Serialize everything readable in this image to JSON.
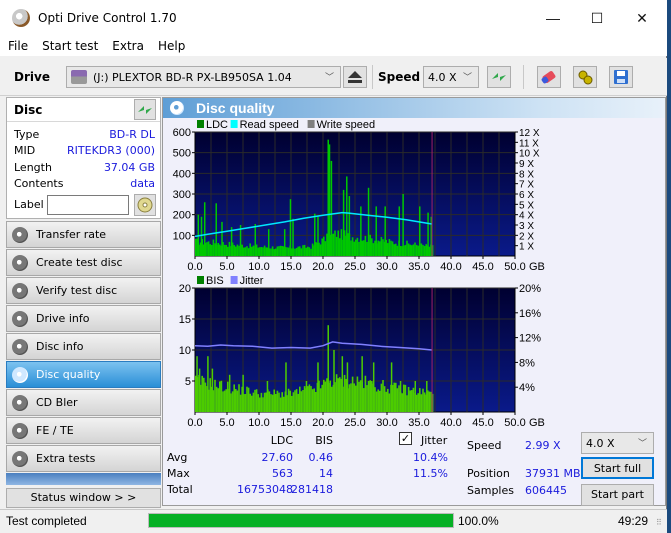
{
  "window": {
    "title": "Opti Drive Control 1.70",
    "controls": {
      "minimize": "—",
      "maximize": "☐",
      "close": "✕"
    }
  },
  "menu": [
    "File",
    "Start test",
    "Extra",
    "Help"
  ],
  "toolbar": {
    "drive_label": "Drive",
    "drive_value": "(J:)  PLEXTOR BD-R  PX-LB950SA 1.04",
    "speed_label": "Speed",
    "speed_value": "4.0 X",
    "icons": [
      "eject-icon",
      "refresh-icon",
      "erase-icon",
      "settings-icon",
      "save-icon"
    ]
  },
  "disc": {
    "title": "Disc",
    "fields": [
      {
        "key": "Type",
        "value": "BD-R DL"
      },
      {
        "key": "MID",
        "value": "RITEKDR3 (000)"
      },
      {
        "key": "Length",
        "value": "37.04 GB"
      },
      {
        "key": "Contents",
        "value": "data"
      }
    ],
    "label_key": "Label",
    "label_value": ""
  },
  "nav": [
    {
      "label": "Transfer rate",
      "active": false
    },
    {
      "label": "Create test disc",
      "active": false
    },
    {
      "label": "Verify test disc",
      "active": false
    },
    {
      "label": "Drive info",
      "active": false
    },
    {
      "label": "Disc info",
      "active": false
    },
    {
      "label": "Disc quality",
      "active": true
    },
    {
      "label": "CD Bler",
      "active": false
    },
    {
      "label": "FE / TE",
      "active": false
    },
    {
      "label": "Extra tests",
      "active": false
    }
  ],
  "status_window_label": "Status window > >",
  "panel": {
    "title": "Disc quality"
  },
  "stats": {
    "col_ldc": "LDC",
    "col_bis": "BIS",
    "jitter_label": "Jitter",
    "jitter_checked": true,
    "rows": [
      {
        "label": "Avg",
        "ldc": "27.60",
        "bis": "0.46",
        "jitter": "10.4%"
      },
      {
        "label": "Max",
        "ldc": "563",
        "bis": "14",
        "jitter": "11.5%"
      },
      {
        "label": "Total",
        "ldc": "16753048",
        "bis": "281418",
        "jitter": ""
      }
    ],
    "speed_label": "Speed",
    "speed_value": "2.99 X",
    "position_label": "Position",
    "position_value": "37931 MB",
    "samples_label": "Samples",
    "samples_value": "606445",
    "speed_select": "4.0 X",
    "start_full": "Start full",
    "start_part": "Start part"
  },
  "statusbar": {
    "text": "Test completed",
    "progress": 1.0,
    "progress_text": "100.0%",
    "time": "49:29"
  },
  "colors": {
    "plot_bg_top": "#000030",
    "plot_bg_bottom": "#0a1a8a",
    "ldc": "#00c800",
    "bis": "#4ccc00",
    "read_speed": "#00e8ff",
    "jitter": "#8080ff",
    "end_marker": "#a0206a"
  },
  "chart_data": [
    {
      "type": "bar",
      "title": "LDC / Read speed",
      "legend": [
        "LDC",
        "Read speed",
        "Write speed"
      ],
      "legend_colors": [
        "#008000",
        "#00ffff",
        "#808080"
      ],
      "xlabel": "GB",
      "x_ticks": [
        "0.0",
        "5.0",
        "10.0",
        "15.0",
        "20.0",
        "25.0",
        "30.0",
        "35.0",
        "40.0",
        "45.0",
        "50.0"
      ],
      "xlim": [
        0,
        50
      ],
      "y_ticks": [
        100,
        200,
        300,
        400,
        500,
        600
      ],
      "ylim": [
        0,
        600
      ],
      "y2_ticks": [
        "1 X",
        "2 X",
        "3 X",
        "4 X",
        "5 X",
        "6 X",
        "7 X",
        "8 X",
        "9 X",
        "10 X",
        "11 X",
        "12 X"
      ],
      "y2lim": [
        0,
        12
      ],
      "data_end_gb": 37.04,
      "ldc_base": [
        [
          0,
          70
        ],
        [
          3,
          65
        ],
        [
          6,
          55
        ],
        [
          10,
          45
        ],
        [
          14,
          40
        ],
        [
          18,
          45
        ],
        [
          20,
          80
        ],
        [
          22,
          110
        ],
        [
          24,
          95
        ],
        [
          27,
          85
        ],
        [
          30,
          70
        ],
        [
          33,
          60
        ],
        [
          37,
          45
        ]
      ],
      "ldc_spikes": [
        [
          0.4,
          200
        ],
        [
          0.9,
          190
        ],
        [
          1.4,
          260
        ],
        [
          3.2,
          255
        ],
        [
          4.1,
          165
        ],
        [
          5.6,
          140
        ],
        [
          7.0,
          150
        ],
        [
          9.3,
          155
        ],
        [
          11.4,
          130
        ],
        [
          13.9,
          130
        ],
        [
          14.8,
          275
        ],
        [
          15.2,
          180
        ],
        [
          18.6,
          205
        ],
        [
          19.1,
          190
        ],
        [
          20.7,
          563
        ],
        [
          20.9,
          540
        ],
        [
          21.2,
          460
        ],
        [
          23.1,
          320
        ],
        [
          23.6,
          385
        ],
        [
          24.0,
          290
        ],
        [
          25.8,
          240
        ],
        [
          27.0,
          330
        ],
        [
          28.2,
          240
        ],
        [
          29.6,
          240
        ],
        [
          31.8,
          240
        ],
        [
          32.4,
          300
        ],
        [
          35.0,
          240
        ],
        [
          36.3,
          210
        ],
        [
          36.8,
          190
        ]
      ],
      "read_speed": [
        [
          0,
          1.9
        ],
        [
          2,
          2.1
        ],
        [
          5,
          2.4
        ],
        [
          8,
          2.7
        ],
        [
          11,
          3.0
        ],
        [
          14,
          3.3
        ],
        [
          17,
          3.65
        ],
        [
          20,
          3.95
        ],
        [
          23,
          4.2
        ],
        [
          24,
          4.15
        ],
        [
          27,
          3.95
        ],
        [
          30,
          3.75
        ],
        [
          33,
          3.5
        ],
        [
          37,
          3.1
        ]
      ]
    },
    {
      "type": "bar",
      "title": "BIS / Jitter",
      "legend": [
        "BIS",
        "Jitter"
      ],
      "legend_colors": [
        "#008000",
        "#8080ff"
      ],
      "xlabel": "GB",
      "x_ticks": [
        "0.0",
        "5.0",
        "10.0",
        "15.0",
        "20.0",
        "25.0",
        "30.0",
        "35.0",
        "40.0",
        "45.0",
        "50.0"
      ],
      "xlim": [
        0,
        50
      ],
      "y_ticks": [
        5,
        10,
        15,
        20
      ],
      "ylim": [
        0,
        20
      ],
      "y2_ticks": [
        "4%",
        "8%",
        "12%",
        "16%",
        "20%"
      ],
      "y2lim": [
        0,
        20
      ],
      "data_end_gb": 37.04,
      "bis_base": [
        [
          0,
          5
        ],
        [
          5,
          4
        ],
        [
          10,
          3
        ],
        [
          15,
          3
        ],
        [
          19,
          4
        ],
        [
          21,
          5
        ],
        [
          25,
          5
        ],
        [
          30,
          4
        ],
        [
          37,
          3
        ]
      ],
      "bis_spikes": [
        [
          0.2,
          9
        ],
        [
          0.6,
          7
        ],
        [
          1.9,
          9
        ],
        [
          2.6,
          7
        ],
        [
          5.3,
          6
        ],
        [
          7.4,
          6
        ],
        [
          11.2,
          5
        ],
        [
          14.1,
          8
        ],
        [
          17.3,
          5
        ],
        [
          19.1,
          8
        ],
        [
          20.7,
          14
        ],
        [
          21.6,
          10
        ],
        [
          22.9,
          9
        ],
        [
          23.7,
          8
        ],
        [
          26.0,
          9
        ],
        [
          27.8,
          8
        ],
        [
          30.6,
          8
        ],
        [
          32.0,
          5
        ],
        [
          34.3,
          5
        ],
        [
          36.1,
          5
        ]
      ],
      "jitter": [
        [
          0,
          10.7
        ],
        [
          2,
          10.6
        ],
        [
          4,
          10.8
        ],
        [
          6,
          10.7
        ],
        [
          9,
          10.6
        ],
        [
          12,
          10.3
        ],
        [
          15,
          10.4
        ],
        [
          18,
          10.3
        ],
        [
          20,
          10.7
        ],
        [
          21.5,
          11.3
        ],
        [
          23,
          11.1
        ],
        [
          26,
          10.9
        ],
        [
          29,
          10.6
        ],
        [
          32,
          10.4
        ],
        [
          35,
          10.2
        ],
        [
          37,
          10.0
        ]
      ]
    }
  ]
}
